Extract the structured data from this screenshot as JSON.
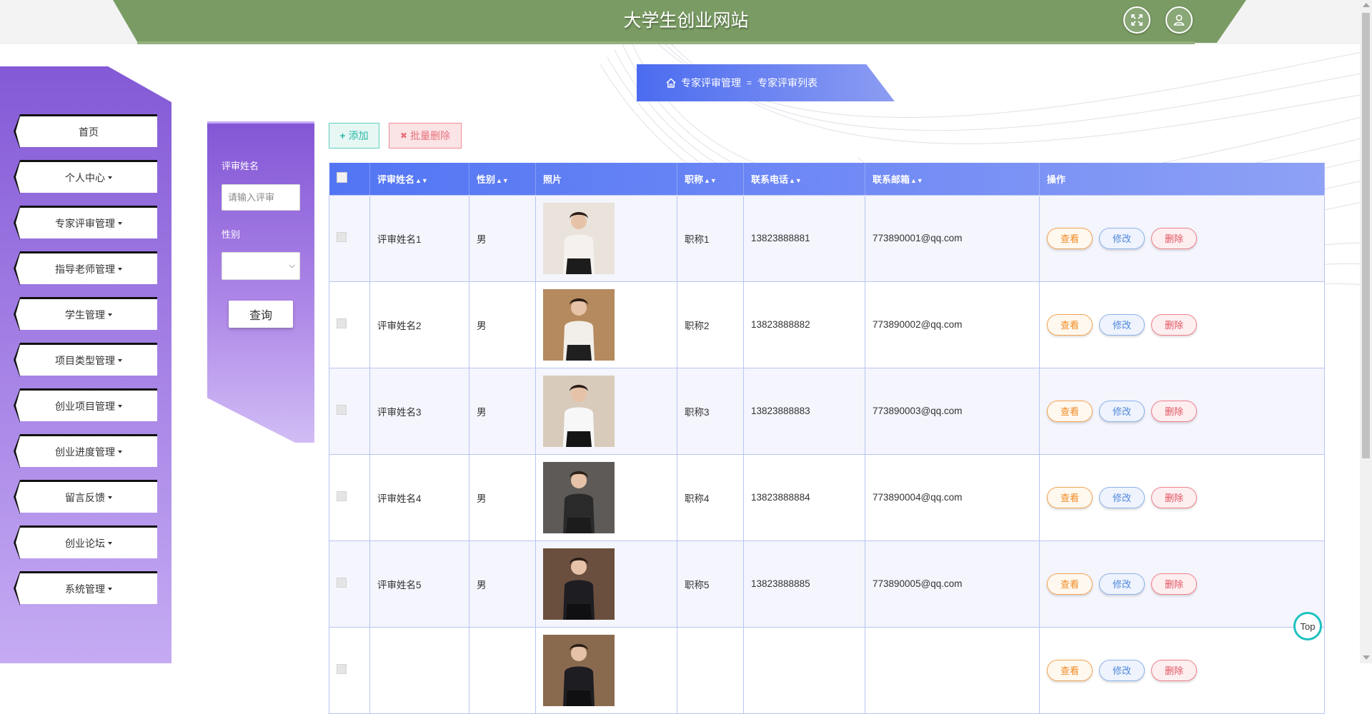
{
  "header": {
    "title": "大学生创业网站",
    "fullscreen_icon": "fullscreen-icon",
    "user_icon": "user-icon"
  },
  "sidebar": {
    "items": [
      {
        "label": "首页",
        "dropdown": false
      },
      {
        "label": "个人中心",
        "dropdown": true
      },
      {
        "label": "专家评审管理",
        "dropdown": true
      },
      {
        "label": "指导老师管理",
        "dropdown": true
      },
      {
        "label": "学生管理",
        "dropdown": true
      },
      {
        "label": "项目类型管理",
        "dropdown": true
      },
      {
        "label": "创业项目管理",
        "dropdown": true
      },
      {
        "label": "创业进度管理",
        "dropdown": true
      },
      {
        "label": "留言反馈",
        "dropdown": true
      },
      {
        "label": "创业论坛",
        "dropdown": true
      },
      {
        "label": "系统管理",
        "dropdown": true
      }
    ]
  },
  "breadcrumb": {
    "home_icon": "home-icon",
    "parent": "专家评审管理",
    "separator": "=",
    "current": "专家评审列表"
  },
  "search": {
    "name_label": "评审姓名",
    "name_placeholder": "请输入评审",
    "name_value": "",
    "gender_label": "性别",
    "gender_value": "",
    "query_label": "查询"
  },
  "actions": {
    "add_label": "添加",
    "batch_delete_label": "批量删除"
  },
  "table": {
    "headers": [
      "评审姓名",
      "性别",
      "照片",
      "职称",
      "联系电话",
      "联系邮箱",
      "操作"
    ],
    "rows": [
      {
        "name": "评审姓名1",
        "gender": "男",
        "title": "职称1",
        "phone": "13823888881",
        "email": "773890001@qq.com"
      },
      {
        "name": "评审姓名2",
        "gender": "男",
        "title": "职称2",
        "phone": "13823888882",
        "email": "773890002@qq.com"
      },
      {
        "name": "评审姓名3",
        "gender": "男",
        "title": "职称3",
        "phone": "13823888883",
        "email": "773890003@qq.com"
      },
      {
        "name": "评审姓名4",
        "gender": "男",
        "title": "职称4",
        "phone": "13823888884",
        "email": "773890004@qq.com"
      },
      {
        "name": "评审姓名5",
        "gender": "男",
        "title": "职称5",
        "phone": "13823888885",
        "email": "773890005@qq.com"
      },
      {
        "name": "",
        "gender": "",
        "title": "",
        "phone": "",
        "email": ""
      }
    ],
    "op_view": "查看",
    "op_edit": "修改",
    "op_delete": "删除"
  },
  "top_button": {
    "label": "Top"
  },
  "colors": {
    "header": "#7a9c64",
    "sidebar": "#8459d6",
    "table_head": "#5275f4",
    "top_ring": "#20c1c1"
  }
}
